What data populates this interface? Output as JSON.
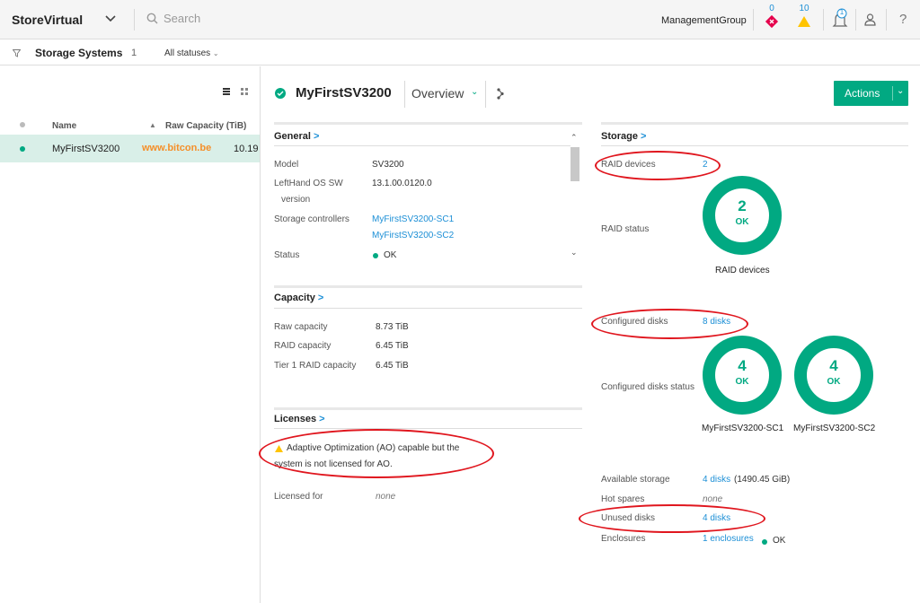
{
  "topbar": {
    "brand": "StoreVirtual",
    "search_placeholder": "Search",
    "group": "ManagementGroup",
    "critical_count": "0",
    "warning_count": "10",
    "notification_count": "1"
  },
  "subbar": {
    "title": "Storage Systems",
    "count": "1",
    "filter": "All statuses"
  },
  "list": {
    "col_name": "Name",
    "col_capacity": "Raw Capacity (TiB)",
    "rows": [
      {
        "name": "MyFirstSV3200",
        "watermark": "www.bitcon.be",
        "capacity": "10.19"
      }
    ]
  },
  "detail": {
    "title": "MyFirstSV3200",
    "view": "Overview",
    "actions_label": "Actions",
    "general": {
      "title": "General",
      "model_label": "Model",
      "model": "SV3200",
      "os_label_1": "LeftHand OS SW",
      "os_label_2": "version",
      "os": "13.1.00.0120.0",
      "controllers_label": "Storage controllers",
      "controller1": "MyFirstSV3200-SC1",
      "controller2": "MyFirstSV3200-SC2",
      "status_label": "Status",
      "status": "OK"
    },
    "capacity": {
      "title": "Capacity",
      "raw_label": "Raw capacity",
      "raw": "8.73 TiB",
      "raid_label": "RAID capacity",
      "raid": "6.45 TiB",
      "tier_label": "Tier 1 RAID capacity",
      "tier": "6.45 TiB"
    },
    "licenses": {
      "title": "Licenses",
      "warning_line1": "Adaptive Optimization (AO) capable but the",
      "warning_line2": "system is not licensed for AO.",
      "licensed_label": "Licensed for",
      "licensed": "none"
    },
    "storage": {
      "title": "Storage",
      "raid_devices_label": "RAID devices",
      "raid_devices": "2",
      "raid_status_label": "RAID status",
      "raid_ring": {
        "count": "2",
        "status": "OK",
        "caption": "RAID devices"
      },
      "configured_label": "Configured disks",
      "configured": "8 disks",
      "configured_status_label": "Configured disks status",
      "disk_rings": [
        {
          "count": "4",
          "status": "OK",
          "caption": "MyFirstSV3200-SC1"
        },
        {
          "count": "4",
          "status": "OK",
          "caption": "MyFirstSV3200-SC2"
        }
      ],
      "available_label": "Available storage",
      "available_link": "4 disks",
      "available_extra": "(1490.45 GiB)",
      "hotspares_label": "Hot spares",
      "hotspares": "none",
      "unused_label": "Unused disks",
      "unused": "4 disks",
      "enclosures_label": "Enclosures",
      "enclosures": "1 enclosures",
      "enclosures_status": "OK"
    }
  },
  "colors": {
    "accent": "#01a982",
    "link": "#1c8fd6",
    "warning": "#ffc400",
    "critical": "#e5004c",
    "annotation": "#e0161e"
  }
}
